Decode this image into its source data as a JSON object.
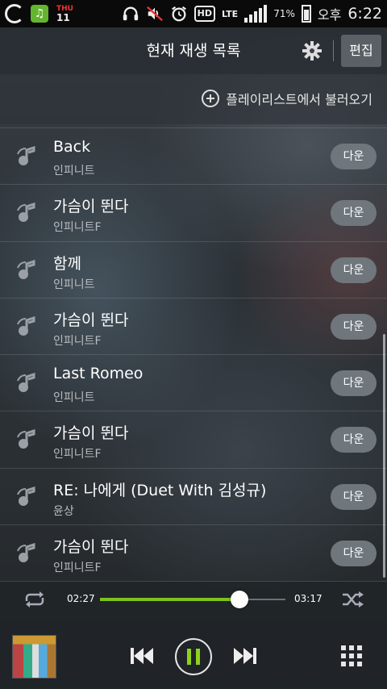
{
  "status_bar": {
    "day": "THU",
    "date": "11",
    "lte": "LTE",
    "hd": "HD",
    "battery_pct": "71%",
    "ampm": "오후",
    "time": "6:22",
    "icons": [
      "olleh-icon",
      "music-app-icon",
      "headset-icon",
      "mute-icon",
      "alarm-icon",
      "hd-voice-icon",
      "lte-icon",
      "signal-icon",
      "battery-icon"
    ]
  },
  "header": {
    "title": "현재 재생 목록",
    "settings_icon": "gear-icon",
    "edit_label": "편집"
  },
  "load_playlist": {
    "label": "플레이리스트에서 불러오기",
    "icon": "plus-circle-icon"
  },
  "tracks": [
    {
      "title": "Back",
      "artist": "인피니트",
      "action": "다운"
    },
    {
      "title": "가슴이 뛴다",
      "artist": "인피니트F",
      "action": "다운"
    },
    {
      "title": "함께",
      "artist": "인피니트",
      "action": "다운"
    },
    {
      "title": "가슴이 뛴다",
      "artist": "인피니트F",
      "action": "다운"
    },
    {
      "title": "Last Romeo",
      "artist": "인피니트",
      "action": "다운"
    },
    {
      "title": "가슴이 뛴다",
      "artist": "인피니트F",
      "action": "다운"
    },
    {
      "title": "RE: 나에게 (Duet With 김성규)",
      "artist": "윤상",
      "action": "다운"
    },
    {
      "title": "가슴이 뛴다",
      "artist": "인피니트F",
      "action": "다운"
    }
  ],
  "player": {
    "current_time": "02:27",
    "total_time": "03:17",
    "progress": 0.75,
    "accent": "#7ec21e"
  }
}
